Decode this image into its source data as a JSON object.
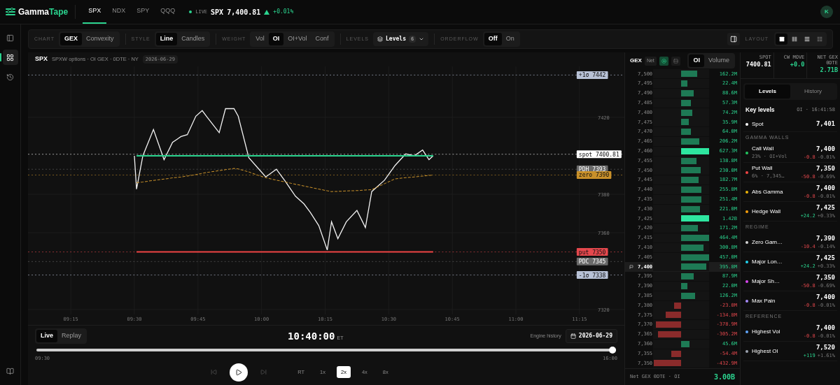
{
  "header": {
    "brand": {
      "first": "Gamma",
      "second": "Tape"
    },
    "tabs": [
      {
        "label": "SPX",
        "selected": true
      },
      {
        "label": "NDX",
        "selected": false
      },
      {
        "label": "SPY",
        "selected": false
      },
      {
        "label": "QQQ",
        "selected": false
      }
    ],
    "live": {
      "label": "LIVE",
      "symbol": "SPX",
      "price": "7,400.81",
      "up": true,
      "change": "+0.01%"
    },
    "avatar": "K"
  },
  "rail": {
    "items": [
      {
        "selected": false
      },
      {
        "selected": true
      },
      {
        "selected": false
      }
    ]
  },
  "toolbar": {
    "groups": [
      {
        "kind": "segmented",
        "label": "CHART",
        "options": [
          {
            "label": "GEX",
            "selected": true
          },
          {
            "label": "Convexity",
            "selected": false
          }
        ]
      },
      {
        "kind": "segmented",
        "label": "STYLE",
        "options": [
          {
            "label": "Line",
            "selected": true
          },
          {
            "label": "Candles",
            "selected": false
          }
        ]
      },
      {
        "kind": "segmented",
        "label": "WEIGHT",
        "options": [
          {
            "label": "Vol",
            "selected": false
          },
          {
            "label": "OI",
            "selected": true
          },
          {
            "label": "OI+Vol",
            "selected": false
          },
          {
            "label": "Conf",
            "selected": false
          }
        ]
      },
      {
        "kind": "dropdown",
        "label": "LEVELS",
        "button": "Levels",
        "count": "6"
      },
      {
        "kind": "segmented",
        "label": "ORDERFLOW",
        "options": [
          {
            "label": "Off",
            "selected": true
          },
          {
            "label": "On",
            "selected": false
          }
        ]
      }
    ],
    "layout": {
      "label": "LAYOUT",
      "options": [
        {
          "selected": true
        },
        {
          "selected": false
        },
        {
          "selected": false
        },
        {
          "selected": false
        }
      ]
    }
  },
  "chart_panel": {
    "symbol": "SPX",
    "subtitle": "SPXW options · OI GEX · 0DTE · NY",
    "date": "2026-06-29",
    "chart_data": {
      "type": "line",
      "grid": true,
      "x": [
        570,
        570.5,
        572,
        574.5,
        577,
        579,
        581,
        582.5,
        584.5,
        586,
        587,
        590,
        591.5,
        593.5,
        594.5,
        597,
        599,
        601,
        603.5,
        605.5,
        608,
        610,
        611.5,
        613.5,
        615.5,
        616.5,
        618,
        620,
        622.5,
        624.5,
        626,
        629,
        631.5,
        634,
        636,
        638,
        639.5,
        640.5
      ],
      "series": [
        {
          "color": "#f2f2f2",
          "line_style": "solid",
          "values": [
            7400,
            7382.7,
            7400,
            7413.7,
            7398,
            7407,
            7410,
            7411,
            7420.6,
            7423.5,
            7420.6,
            7412,
            7424.5,
            7424.5,
            7420.6,
            7399,
            7394,
            7389,
            7393,
            7387,
            7379,
            7375,
            7370.6,
            7363.7,
            7351,
            7365.7,
            7356.9,
            7365.7,
            7371.6,
            7362.7,
            7381.4,
            7387.3,
            7395,
            7401,
            7400,
            7403,
            7398,
            7400
          ]
        },
        {
          "color": "#c8902a",
          "line_style": "dashed",
          "values": [
            null,
            7386,
            7386.4,
            7387.2,
            7387.9,
            7388.5,
            7389,
            7389.5,
            7390.2,
            7390.9,
            7391.3,
            7392.3,
            7392.8,
            7393.4,
            7393.2,
            7391.6,
            7390,
            7388.6,
            7387.3,
            7386.4,
            7385.2,
            7384.3,
            7383.6,
            7382.7,
            7381.8,
            7381.4,
            7381.5,
            7381.7,
            7381.9,
            7382.2,
            7382.4,
            7385.5,
            7388,
            7388.6,
            7389,
            7389.4,
            7389.8,
            7390
          ]
        },
        {
          "color": "#2bd48f",
          "line_style": "solid",
          "values": [
            null,
            7400,
            7400,
            7400,
            7400,
            7400,
            7400,
            7400,
            7400,
            7400,
            7400,
            7400,
            7400,
            7400,
            7400,
            7400,
            7400,
            7400,
            7400,
            7400,
            7400,
            7400,
            7400,
            7400,
            7400,
            7400,
            7400,
            7400,
            7400,
            7400,
            7400,
            7400,
            7400,
            7400,
            7400,
            7400,
            7400,
            7400
          ]
        },
        {
          "color": "#ef4444",
          "line_style": "solid",
          "values": [
            null,
            7350,
            7350,
            7350,
            7350,
            7350,
            7350,
            7350,
            7350,
            7350,
            7350,
            7350,
            7350,
            7350,
            7350,
            7350,
            7350,
            7350,
            7350,
            7350,
            7350,
            7350,
            7350,
            7350,
            7350,
            7350,
            7350,
            7350,
            7350,
            7350,
            7350,
            7350,
            7350,
            7350,
            7350,
            7350,
            7350,
            7350
          ]
        }
      ],
      "xlim": [
        544.9,
        685.6
      ],
      "ylim": [
        7317.5,
        7446.5
      ],
      "xticks": [
        {
          "value": 555,
          "label": "09:15"
        },
        {
          "value": 570,
          "label": "09:30"
        },
        {
          "value": 585,
          "label": "09:45"
        },
        {
          "value": 600,
          "label": "10:00"
        },
        {
          "value": 615,
          "label": "10:15"
        },
        {
          "value": 630,
          "label": "10:30"
        },
        {
          "value": 645,
          "label": "10:45"
        },
        {
          "value": 660,
          "label": "11:00"
        },
        {
          "value": 675,
          "label": "11:15"
        }
      ],
      "yticks": [
        7320,
        7360,
        7380,
        7420
      ],
      "ref_lines": [
        {
          "axis": "y",
          "value": 7442,
          "label": "+1σ 7442",
          "color": "#b8c2d6"
        },
        {
          "axis": "y",
          "value": 7400.81,
          "label": "spot 7400.81",
          "color": "#ffffff"
        },
        {
          "axis": "y",
          "value": 7393,
          "label": "PDH 7393",
          "color": "#6a6a6a"
        },
        {
          "axis": "y",
          "value": 7390,
          "label": "zero 7390",
          "color": "#c8902a"
        },
        {
          "axis": "y",
          "value": 7350,
          "label": "put 7350",
          "color": "#e5484d"
        },
        {
          "axis": "y",
          "value": 7345,
          "label": "PDC 7345",
          "color": "#6a6a6a"
        },
        {
          "axis": "y",
          "value": 7338,
          "label": "-1σ 7338",
          "color": "#b8c2d6"
        }
      ]
    }
  },
  "playback": {
    "modes": [
      {
        "label": "Live",
        "selected": true
      },
      {
        "label": "Replay",
        "selected": false
      }
    ],
    "time": "10:40:00",
    "tz": "ET",
    "history_label": "Engine history",
    "date": "2026-06-29",
    "progress": {
      "level": 1,
      "start": "09:30",
      "end": "16:00"
    },
    "speeds": [
      {
        "label": "RT",
        "selected": false
      },
      {
        "label": "1x",
        "selected": false
      },
      {
        "label": "2x",
        "selected": true
      },
      {
        "label": "4x",
        "selected": false
      },
      {
        "label": "8x",
        "selected": false
      }
    ]
  },
  "ladder": {
    "title": "GEX",
    "net": "Net",
    "views": [
      {
        "selected": true
      },
      {
        "selected": false
      }
    ],
    "weights": [
      {
        "label": "OI",
        "selected": true
      },
      {
        "label": "Volume",
        "selected": false
      }
    ],
    "rows": [
      {
        "strike": "7,500",
        "value": "162.2M",
        "kind": "positive",
        "level": 0.58,
        "highlight": false,
        "current": false
      },
      {
        "strike": "7,495",
        "value": "22.4M",
        "kind": "positive",
        "level": 0.22,
        "highlight": false,
        "current": false
      },
      {
        "strike": "7,490",
        "value": "88.6M",
        "kind": "positive",
        "level": 0.44,
        "highlight": false,
        "current": false
      },
      {
        "strike": "7,485",
        "value": "57.3M",
        "kind": "positive",
        "level": 0.35,
        "highlight": false,
        "current": false
      },
      {
        "strike": "7,480",
        "value": "74.2M",
        "kind": "positive",
        "level": 0.4,
        "highlight": false,
        "current": false
      },
      {
        "strike": "7,475",
        "value": "35.9M",
        "kind": "positive",
        "level": 0.27,
        "highlight": false,
        "current": false
      },
      {
        "strike": "7,470",
        "value": "64.0M",
        "kind": "positive",
        "level": 0.36,
        "highlight": false,
        "current": false
      },
      {
        "strike": "7,465",
        "value": "206.2M",
        "kind": "positive",
        "level": 0.66,
        "highlight": false,
        "current": false
      },
      {
        "strike": "7,460",
        "value": "627.3M",
        "kind": "positive",
        "level": 1,
        "highlight": true,
        "current": false
      },
      {
        "strike": "7,455",
        "value": "138.8M",
        "kind": "positive",
        "level": 0.55,
        "highlight": false,
        "current": false
      },
      {
        "strike": "7,450",
        "value": "230.0M",
        "kind": "positive",
        "level": 0.7,
        "highlight": false,
        "current": false
      },
      {
        "strike": "7,445",
        "value": "182.7M",
        "kind": "positive",
        "level": 0.62,
        "highlight": false,
        "current": false
      },
      {
        "strike": "7,440",
        "value": "255.8M",
        "kind": "positive",
        "level": 0.73,
        "highlight": false,
        "current": false
      },
      {
        "strike": "7,435",
        "value": "251.4M",
        "kind": "positive",
        "level": 0.73,
        "highlight": false,
        "current": false
      },
      {
        "strike": "7,430",
        "value": "221.0M",
        "kind": "positive",
        "level": 0.68,
        "highlight": false,
        "current": false
      },
      {
        "strike": "7,425",
        "value": "1.42B",
        "kind": "positive",
        "level": 1,
        "highlight": true,
        "current": false
      },
      {
        "strike": "7,420",
        "value": "171.2M",
        "kind": "positive",
        "level": 0.6,
        "highlight": false,
        "current": false
      },
      {
        "strike": "7,415",
        "value": "464.4M",
        "kind": "positive",
        "level": 1,
        "highlight": false,
        "current": false
      },
      {
        "strike": "7,410",
        "value": "300.8M",
        "kind": "positive",
        "level": 0.8,
        "highlight": false,
        "current": false
      },
      {
        "strike": "7,405",
        "value": "457.0M",
        "kind": "positive",
        "level": 0.99,
        "highlight": false,
        "current": false
      },
      {
        "strike": "7,400",
        "value": "395.8M",
        "kind": "positive",
        "level": 0.91,
        "highlight": false,
        "current": true
      },
      {
        "strike": "7,395",
        "value": "87.9M",
        "kind": "positive",
        "level": 0.44,
        "highlight": false,
        "current": false
      },
      {
        "strike": "7,390",
        "value": "22.0M",
        "kind": "positive",
        "level": 0.22,
        "highlight": false,
        "current": false
      },
      {
        "strike": "7,385",
        "value": "126.2M",
        "kind": "positive",
        "level": 0.51,
        "highlight": false,
        "current": false
      },
      {
        "strike": "7,380",
        "value": "-23.0M",
        "kind": "negative",
        "level": 0.24,
        "highlight": false,
        "current": false
      },
      {
        "strike": "7,375",
        "value": "-134.8M",
        "kind": "negative",
        "level": 0.56,
        "highlight": false,
        "current": false
      },
      {
        "strike": "7,370",
        "value": "-378.9M",
        "kind": "negative",
        "level": 0.91,
        "highlight": false,
        "current": false
      },
      {
        "strike": "7,365",
        "value": "-305.2M",
        "kind": "negative",
        "level": 0.83,
        "highlight": false,
        "current": false
      },
      {
        "strike": "7,360",
        "value": "45.6M",
        "kind": "positive",
        "level": 0.31,
        "highlight": false,
        "current": false
      },
      {
        "strike": "7,355",
        "value": "-54.4M",
        "kind": "negative",
        "level": 0.35,
        "highlight": false,
        "current": false
      },
      {
        "strike": "7,350",
        "value": "-432.9M",
        "kind": "negative",
        "level": 0.98,
        "highlight": false,
        "current": false
      }
    ],
    "footer": {
      "label": "Net GEX 0DTE · OI",
      "value": "3.00B"
    }
  },
  "stats": [
    {
      "label": "SPOT",
      "value": "7400.81",
      "positive": false
    },
    {
      "label": "CW MOVE",
      "value": "+0.0",
      "positive": true
    },
    {
      "label": "NET GEX 0DTE",
      "value": "2.71B",
      "positive": true
    }
  ],
  "levels_panel": {
    "tabs": [
      {
        "label": "Levels",
        "selected": true
      },
      {
        "label": "History",
        "selected": false
      }
    ],
    "title": "Key levels",
    "meta": "OI · 16:41:58",
    "sections": [
      {
        "items": [
          {
            "name": "Spot",
            "color": "#ffffff",
            "value": "7,401"
          }
        ]
      },
      {
        "title": "GAMMA WALLS",
        "items": [
          {
            "name": "Call Wall",
            "color": "#22c55e",
            "sub": "23% · OI+Vol",
            "value": "7,400",
            "change": "-0.8",
            "pct": "-0.01%",
            "up": false
          },
          {
            "name": "Put Wall",
            "color": "#ef4444",
            "sub": "6% · 7,345…",
            "value": "7,350",
            "change": "-50.8",
            "pct": "-0.69%",
            "up": false
          },
          {
            "name": "Abs Gamma",
            "color": "#eab308",
            "value": "7,400",
            "change": "-0.8",
            "pct": "-0.01%",
            "up": false
          },
          {
            "name": "Hedge Wall",
            "color": "#f59e0b",
            "value": "7,425",
            "change": "+24.2",
            "pct": "+0.33%",
            "up": true
          }
        ]
      },
      {
        "title": "REGIME",
        "items": [
          {
            "name": "Zero Gam…",
            "color": "#d4d4d4",
            "value": "7,390",
            "change": "-10.4",
            "pct": "-0.14%",
            "up": false
          },
          {
            "name": "Major Lon…",
            "color": "#22d3ee",
            "value": "7,425",
            "change": "+24.2",
            "pct": "+0.33%",
            "up": true
          },
          {
            "name": "Major Sh…",
            "color": "#d946ef",
            "value": "7,350",
            "change": "-50.8",
            "pct": "-0.69%",
            "up": false
          },
          {
            "name": "Max Pain",
            "color": "#a78bfa",
            "value": "7,400",
            "change": "-0.8",
            "pct": "-0.01%",
            "up": false
          }
        ]
      },
      {
        "title": "REFERENCE",
        "items": [
          {
            "name": "Highest Vol",
            "color": "#60a5fa",
            "value": "7,400",
            "change": "-0.8",
            "pct": "-0.01%",
            "up": false
          },
          {
            "name": "Highest OI",
            "color": "#9ca3af",
            "value": "7,520",
            "change": "+119",
            "pct": "+1.61%",
            "up": true
          }
        ]
      }
    ]
  }
}
